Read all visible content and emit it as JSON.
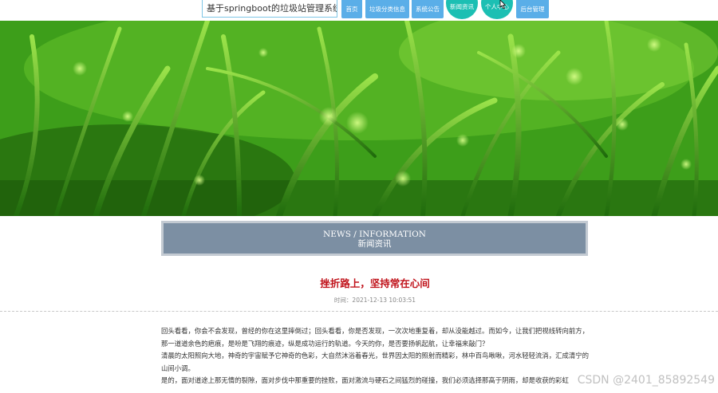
{
  "site": {
    "title": "基于springboot的垃圾站管理系统"
  },
  "nav": {
    "items": [
      {
        "label": "首页"
      },
      {
        "label": "垃圾分类信息"
      },
      {
        "label": "系统公告"
      },
      {
        "label": "新闻资讯"
      },
      {
        "label": "个人中心"
      },
      {
        "label": "后台管理"
      }
    ]
  },
  "section": {
    "title_en": "NEWS / INFORMATION",
    "title_cn": "新闻资讯"
  },
  "article": {
    "title": "挫折路上，坚持常在心间",
    "meta": "时间：2021-12-13 10:03:51",
    "paragraphs": [
      "回头看看，你会不会发现，曾经的你在这里摔倒过；回头看看，你是否发现，一次次地重复着，却从没能越过。而如今，让我们把视线转向前方，那一道道余色的疤痕，是吩是飞翔的痕迹，纵是成功运行的轨道。今天的你，是否要扬帆起航，让幸福来敲门？",
      "清晨的太阳照向大地，神奇的宇宙赋予它神奇的色彩，大自然沐浴着春光，世界因太阳的照射而精彩，林中百鸟啾啾，河水轻轻流淌，汇成清宁的山间小调。",
      "是的，面对道途上那无情的裂隙，面对步伐中那重要的挫败，面对激流与硬石之间猛烈的碰撞，我们必须选择那高于阴雨，却是收获的彩虹"
    ]
  },
  "watermark": "CSDN @2401_85892549",
  "colors": {
    "nav_button": "#5aaee8",
    "nav_active": "#1cbfb3",
    "section_header_bg": "#7c8fa3",
    "article_title": "#c0121a"
  }
}
